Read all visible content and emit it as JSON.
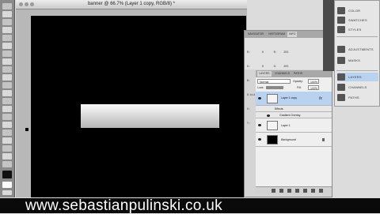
{
  "document": {
    "title": "banner @ 66.7% (Layer 1 copy, RGB/8) *"
  },
  "info_panel": {
    "tabs": [
      "NAVIGATOR",
      "HISTOGRAM",
      "INFO"
    ],
    "active_tab": "INFO",
    "rows": [
      "R:       0      R:    255",
      "G:       0      G:    255",
      "B:       0      B:    255",
      "8-bit           8-bit",
      "X:   -.51       W:   8.36",
      "Y:   1.64       H:   1.04"
    ]
  },
  "layers_panel": {
    "tabs": [
      "LAYERS",
      "CHANNELS",
      "PATHS"
    ],
    "active_tab": "LAYERS",
    "blend_mode": "Normal",
    "opacity_label": "Opacity:",
    "opacity_value": "100%",
    "lock_label": "Lock:",
    "fill_label": "Fill:",
    "fill_value": "100%",
    "layers": [
      {
        "name": "Layer 1 copy",
        "selected": true
      },
      {
        "name": "Effects",
        "selected": false
      },
      {
        "name": "Gradient Overlay",
        "selected": false
      },
      {
        "name": "Layer 1",
        "selected": false
      },
      {
        "name": "Background",
        "selected": false
      }
    ]
  },
  "dock": {
    "items": [
      "COLOR",
      "SWATCHES",
      "STYLES",
      "ADJUSTMENTS",
      "MASKS",
      "LAYERS",
      "CHANNELS",
      "PATHS"
    ],
    "active": "LAYERS"
  },
  "footer": {
    "url": "www.sebastianpulinski.co.uk"
  },
  "colors": {
    "canvas": "#000000",
    "selection": "#b9d2f0",
    "url_bar": "#0a0a0a"
  }
}
